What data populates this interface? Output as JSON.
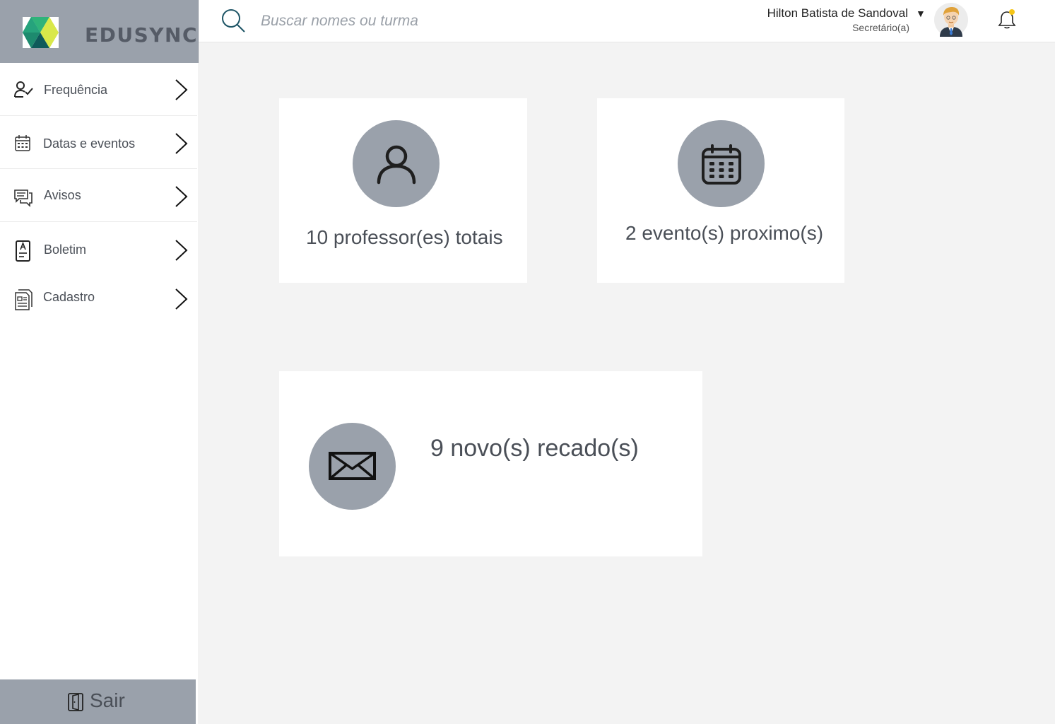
{
  "brand": {
    "name": "EDUSYNC"
  },
  "sidebar": {
    "items": [
      {
        "label": "Frequência",
        "icon": "user-check-icon"
      },
      {
        "label": "Datas e eventos",
        "icon": "calendar-icon"
      },
      {
        "label": "Avisos",
        "icon": "chat-icon"
      },
      {
        "label": "Boletim",
        "icon": "report-card-icon"
      },
      {
        "label": "Cadastro",
        "icon": "documents-icon"
      }
    ],
    "logout_label": "Sair"
  },
  "search": {
    "placeholder": "Buscar nomes ou turma"
  },
  "user": {
    "name": "Hilton Batista de Sandoval",
    "role": "Secretário(a)"
  },
  "cards": {
    "teachers": "10 professor(es) totais",
    "events": "2 evento(s) proximo(s)",
    "messages": "9 novo(s) recado(s)"
  },
  "colors": {
    "sidebar_header": "#9aa1ab",
    "icon_circle": "#9aa1ab",
    "notification_dot": "#f5c518",
    "background": "#f3f3f3"
  }
}
